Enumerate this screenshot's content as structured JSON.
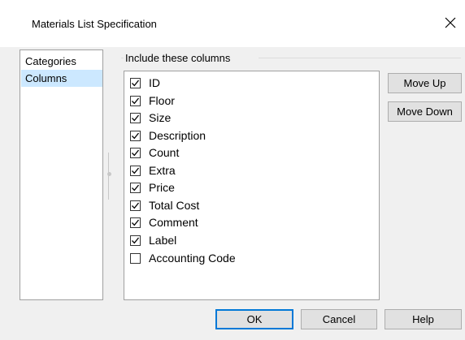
{
  "window": {
    "title": "Materials List Specification",
    "close_glyph": "✕"
  },
  "nav": {
    "items": [
      {
        "label": "Categories",
        "selected": false
      },
      {
        "label": "Columns",
        "selected": true
      }
    ]
  },
  "columns_group": {
    "label": "Include these columns",
    "items": [
      {
        "label": "ID",
        "checked": true
      },
      {
        "label": "Floor",
        "checked": true
      },
      {
        "label": "Size",
        "checked": true
      },
      {
        "label": "Description",
        "checked": true
      },
      {
        "label": "Count",
        "checked": true
      },
      {
        "label": "Extra",
        "checked": true
      },
      {
        "label": "Price",
        "checked": true
      },
      {
        "label": "Total Cost",
        "checked": true
      },
      {
        "label": "Comment",
        "checked": true
      },
      {
        "label": "Label",
        "checked": true
      },
      {
        "label": "Accounting Code",
        "checked": false
      }
    ]
  },
  "side_buttons": {
    "move_up": "Move Up",
    "move_down": "Move Down"
  },
  "footer": {
    "ok": "OK",
    "cancel": "Cancel",
    "help": "Help"
  },
  "icons": {
    "checkmark": "checkmark-icon",
    "close": "close-icon",
    "splitter": "splitter-grip-icon"
  }
}
